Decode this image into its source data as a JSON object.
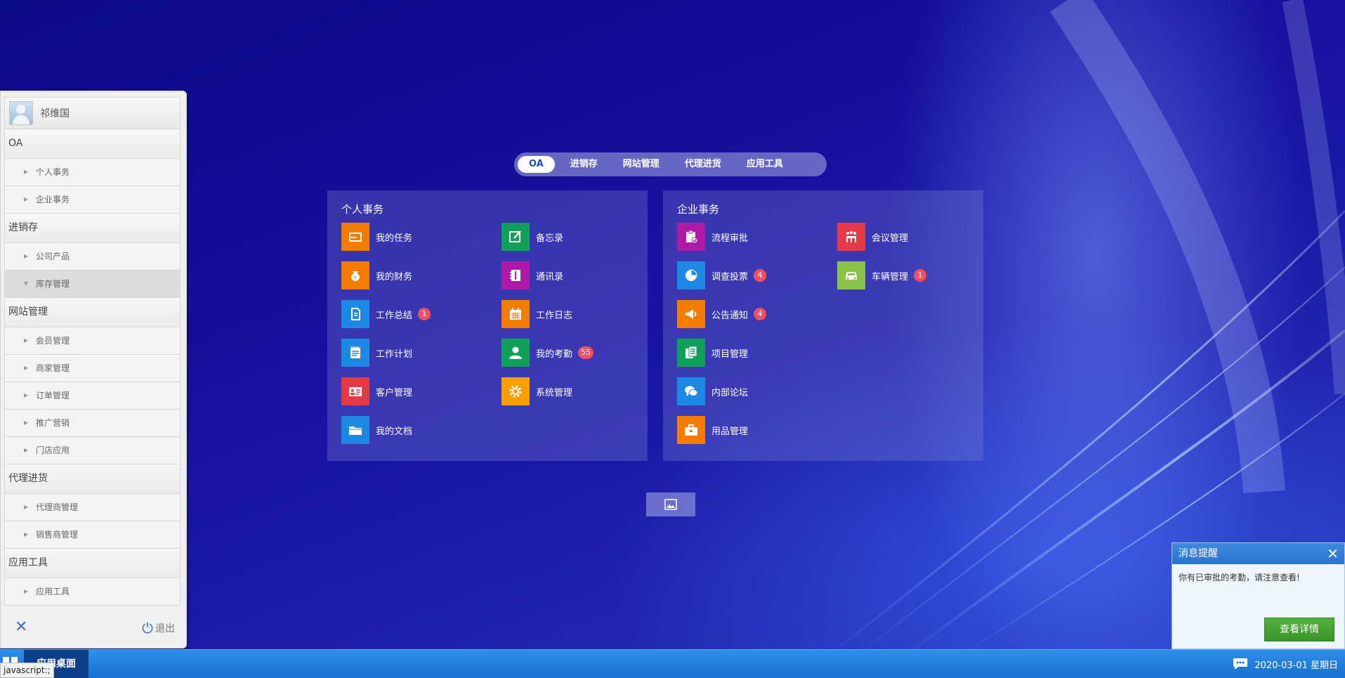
{
  "sidebar": {
    "user_name": "祁维国",
    "groups": [
      {
        "label": "OA",
        "items": [
          {
            "label": "个人事务"
          },
          {
            "label": "企业事务"
          }
        ]
      },
      {
        "label": "进销存",
        "items": [
          {
            "label": "公司产品"
          },
          {
            "label": "库存管理",
            "active": true
          }
        ]
      },
      {
        "label": "网站管理",
        "items": [
          {
            "label": "会员管理"
          },
          {
            "label": "商家管理"
          },
          {
            "label": "订单管理"
          },
          {
            "label": "推广营销"
          },
          {
            "label": "门店应用"
          }
        ]
      },
      {
        "label": "代理进货",
        "items": [
          {
            "label": "代理商管理"
          },
          {
            "label": "销售商管理"
          }
        ]
      },
      {
        "label": "应用工具",
        "items": [
          {
            "label": "应用工具"
          }
        ]
      }
    ],
    "logout_label": "退出"
  },
  "tabs": [
    {
      "label": "OA",
      "active": true
    },
    {
      "label": "进销存"
    },
    {
      "label": "网站管理"
    },
    {
      "label": "代理进货"
    },
    {
      "label": "应用工具"
    }
  ],
  "panels": {
    "personal": {
      "title": "个人事务",
      "apps": [
        {
          "label": "我的任务",
          "color": "#f57c00",
          "icon": "envelope-icon"
        },
        {
          "label": "备忘录",
          "color": "#0fa05a",
          "icon": "edit-icon"
        },
        {
          "label": "我的财务",
          "color": "#f57c00",
          "icon": "money-bag-icon"
        },
        {
          "label": "通讯录",
          "color": "#b01aa8",
          "icon": "address-book-icon"
        },
        {
          "label": "工作总结",
          "color": "#1e88e5",
          "icon": "document-icon",
          "badge": "1"
        },
        {
          "label": "工作日志",
          "color": "#f57c00",
          "icon": "calendar-icon"
        },
        {
          "label": "工作计划",
          "color": "#1e88e5",
          "icon": "notepad-icon"
        },
        {
          "label": "我的考勤",
          "color": "#0fa05a",
          "icon": "user-icon",
          "badge": "55"
        },
        {
          "label": "客户管理",
          "color": "#e53945",
          "icon": "id-card-icon"
        },
        {
          "label": "系统管理",
          "color": "#f5a000",
          "icon": "gear-icon"
        },
        {
          "label": "我的文档",
          "color": "#1e88e5",
          "icon": "folder-icon"
        }
      ]
    },
    "enterprise": {
      "title": "企业事务",
      "apps": [
        {
          "label": "流程审批",
          "color": "#b01aa8",
          "icon": "clipboard-check-icon"
        },
        {
          "label": "会议管理",
          "color": "#e53945",
          "icon": "meeting-icon"
        },
        {
          "label": "调查投票",
          "color": "#1e88e5",
          "icon": "pie-chart-icon",
          "badge": "4"
        },
        {
          "label": "车辆管理",
          "color": "#8bc34a",
          "icon": "car-icon",
          "badge": "1"
        },
        {
          "label": "公告通知",
          "color": "#f57c00",
          "icon": "megaphone-icon",
          "badge": "4"
        },
        {
          "label": "",
          "color": "",
          "icon": ""
        },
        {
          "label": "项目管理",
          "color": "#0fa05a",
          "icon": "documents-icon"
        },
        {
          "label": "",
          "color": "",
          "icon": ""
        },
        {
          "label": "内部论坛",
          "color": "#1e88e5",
          "icon": "chat-bubbles-icon"
        },
        {
          "label": "",
          "color": "",
          "icon": ""
        },
        {
          "label": "用品管理",
          "color": "#f57c00",
          "icon": "briefcase-icon"
        }
      ]
    }
  },
  "notification": {
    "title": "消息提醒",
    "message": "你有已审批的考勤，请注意查看!",
    "button_label": "查看详情"
  },
  "taskbar": {
    "app_label": "应用桌面",
    "datetime": "2020-03-01 星期日"
  },
  "status_bar": {
    "url": "javascript:;"
  }
}
